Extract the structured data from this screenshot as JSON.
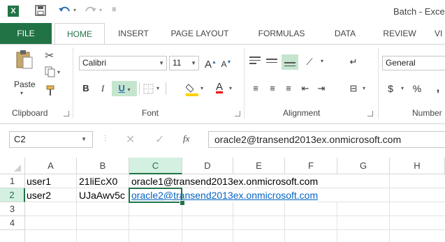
{
  "window": {
    "app_icon": "X",
    "title": "Batch - Exce"
  },
  "quick_access": {
    "save_icon": "save-icon",
    "undo_icon": "undo-icon",
    "redo_icon": "redo-icon"
  },
  "tabs": [
    "FILE",
    "HOME",
    "INSERT",
    "PAGE LAYOUT",
    "FORMULAS",
    "DATA",
    "REVIEW",
    "VI"
  ],
  "ribbon": {
    "clipboard": {
      "paste": "Paste",
      "label": "Clipboard"
    },
    "font": {
      "name": "Calibri",
      "size": "11",
      "label": "Font",
      "bold": "B",
      "italic": "I",
      "underline": "U",
      "grow": "A",
      "shrink": "A"
    },
    "alignment": {
      "label": "Alignment"
    },
    "number": {
      "format": "General",
      "label": "Number",
      "currency": "$",
      "percent": "%",
      "comma": ","
    }
  },
  "formula_bar": {
    "name_box": "C2",
    "fx": "fx",
    "value": "oracle2@transend2013ex.onmicrosoft.com"
  },
  "grid": {
    "columns": [
      "A",
      "B",
      "C",
      "D",
      "E",
      "F",
      "G",
      "H"
    ],
    "rows": [
      "1",
      "2",
      "3",
      "4"
    ],
    "cells": [
      [
        "user1",
        "21liEcX0",
        "oracle1@transend2013ex.onmicrosoft.com"
      ],
      [
        "user2",
        "UJaAwv5c",
        "oracle2@transend2013ex.onmicrosoft.com"
      ]
    ]
  },
  "colors": {
    "accent": "#217346",
    "hyperlink": "#0563c1"
  }
}
